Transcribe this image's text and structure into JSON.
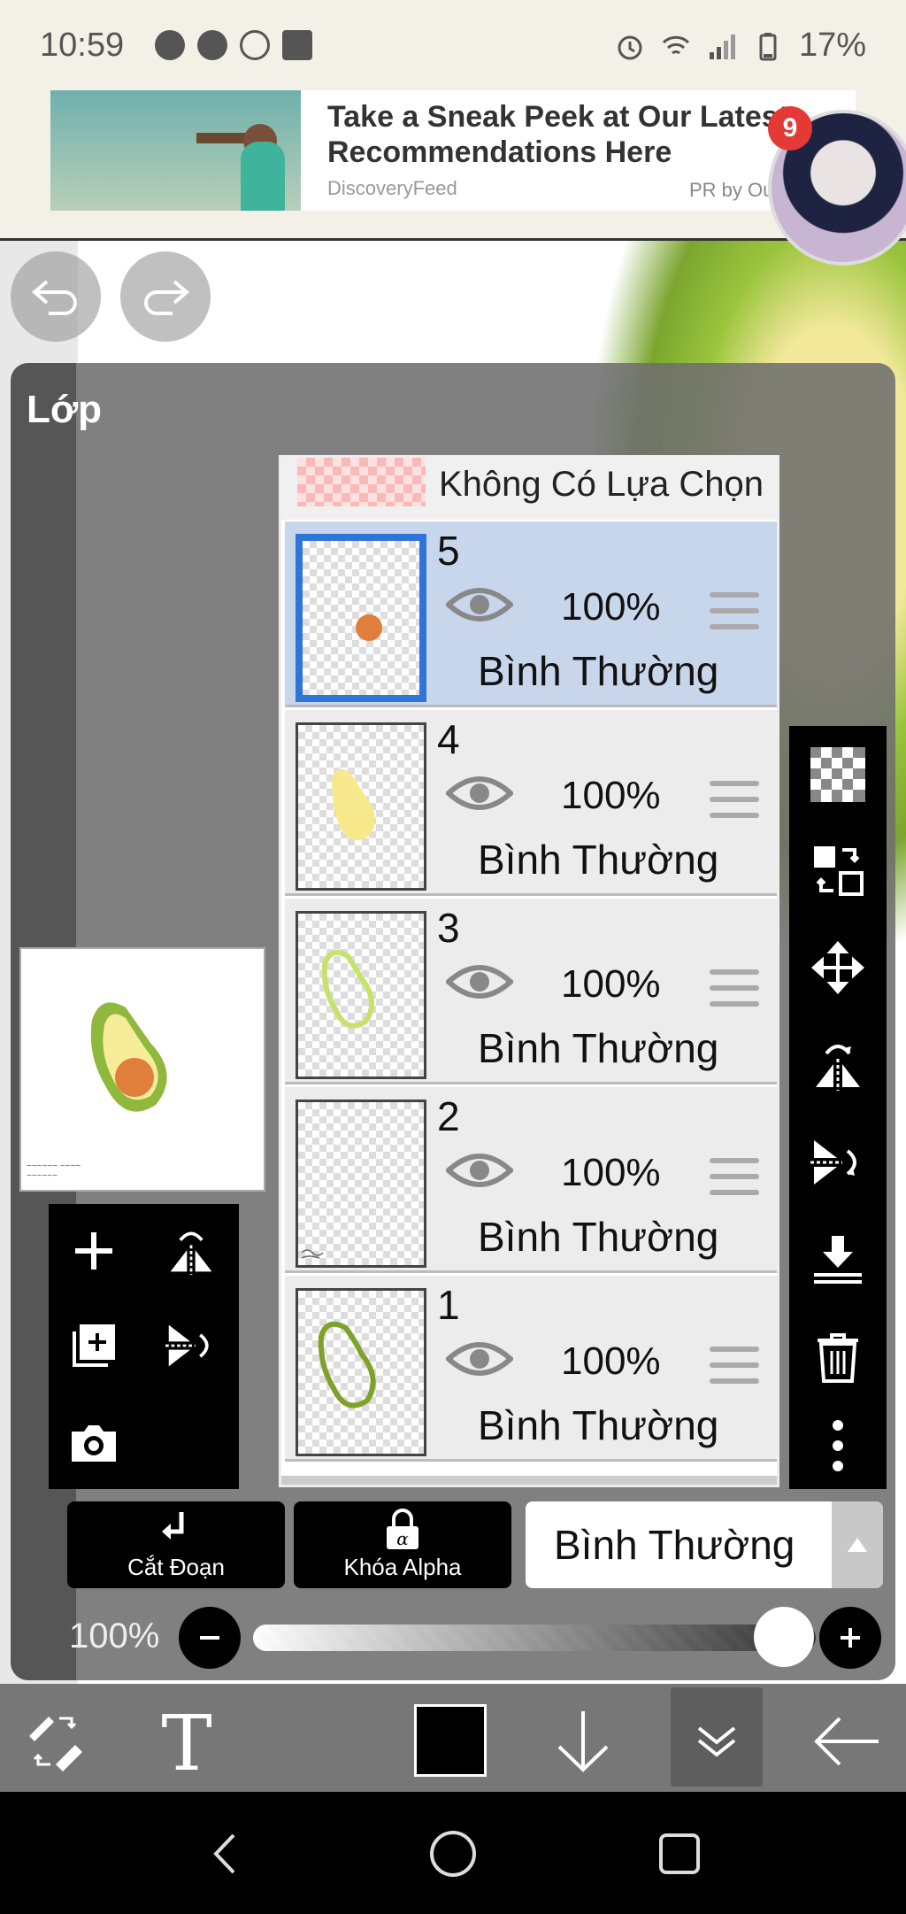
{
  "status_bar": {
    "time": "10:59",
    "battery": "17%",
    "notification_icons": [
      "messenger-icon",
      "messenger-icon",
      "messenger-outline-icon",
      "image-icon"
    ],
    "system_icons": [
      "alarm-icon",
      "wifi-icon",
      "signal-icon",
      "battery-icon"
    ]
  },
  "ad": {
    "title": "Take a Sneak Peek at Our Latest Recommendations Here",
    "source": "DiscoveryFeed",
    "pr": "PR by Outbrain"
  },
  "chat_bubble": {
    "badge": "9"
  },
  "panel": {
    "title": "Lớp"
  },
  "layers": {
    "no_selection_label": "Không Có Lựa Chọn",
    "items": [
      {
        "number": "5",
        "opacity": "100%",
        "mode": "Bình Thường",
        "selected": true
      },
      {
        "number": "4",
        "opacity": "100%",
        "mode": "Bình Thường",
        "selected": false
      },
      {
        "number": "3",
        "opacity": "100%",
        "mode": "Bình Thường",
        "selected": false
      },
      {
        "number": "2",
        "opacity": "100%",
        "mode": "Bình Thường",
        "selected": false
      },
      {
        "number": "1",
        "opacity": "100%",
        "mode": "Bình Thường",
        "selected": false
      }
    ]
  },
  "layer_tools": {
    "clip_label": "Cắt Đoạn",
    "alpha_lock_label": "Khóa Alpha",
    "blend_mode": "Bình Thường"
  },
  "opacity_slider": {
    "label": "100%",
    "value_fraction": 1.0
  },
  "colors": {
    "accent": "#2f74d8",
    "selected_layer": "#c8d6ec",
    "avocado_outer": "#8fb83d",
    "avocado_inner": "#f6ec9a",
    "avocado_pit": "#e07e3c"
  }
}
